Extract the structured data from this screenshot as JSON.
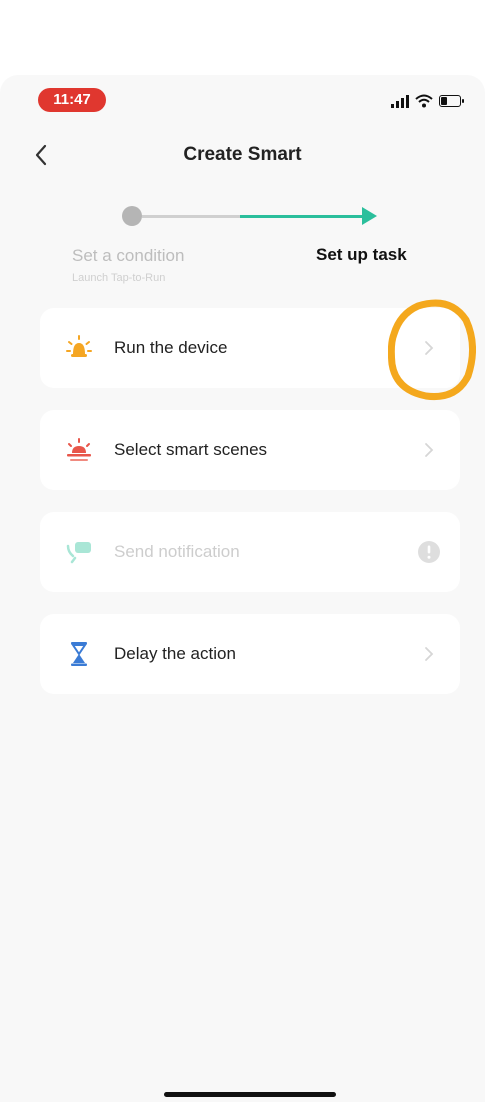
{
  "status": {
    "time": "11:47"
  },
  "header": {
    "title": "Create Smart"
  },
  "stepper": {
    "step1": {
      "label": "Set a condition",
      "sub": "Launch Tap-to-Run"
    },
    "step2": {
      "label": "Set up task"
    },
    "active_color": "#2bbf9c",
    "inactive_color": "#b5b5b5"
  },
  "tasks": [
    {
      "label": "Run the device",
      "icon": "bulb-icon",
      "color": "#f5a623"
    },
    {
      "label": "Select smart scenes",
      "icon": "sunset-icon",
      "color": "#e8564a"
    },
    {
      "label": "Send notification",
      "icon": "message-icon",
      "color": "#7fd9c4",
      "disabled": true
    },
    {
      "label": "Delay the action",
      "icon": "hourglass-icon",
      "color": "#3a7bd5"
    }
  ],
  "annotation": {
    "color": "#f4a81d"
  }
}
